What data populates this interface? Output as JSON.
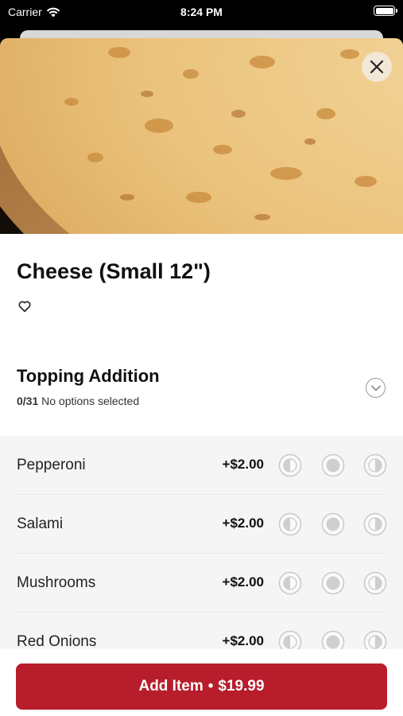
{
  "status_bar": {
    "carrier": "Carrier",
    "time": "8:24 PM"
  },
  "item": {
    "title": "Cheese (Small 12\")"
  },
  "modifier_group": {
    "title": "Topping Addition",
    "selected_count": "0/31",
    "status_text": "No options selected"
  },
  "options": [
    {
      "name": "Pepperoni",
      "price": "+$2.00"
    },
    {
      "name": "Salami",
      "price": "+$2.00"
    },
    {
      "name": "Mushrooms",
      "price": "+$2.00"
    },
    {
      "name": "Red Onions",
      "price": "+$2.00"
    }
  ],
  "footer": {
    "add_label": "Add Item",
    "separator": "•",
    "total": "$19.99"
  },
  "colors": {
    "accent": "#b71d2a",
    "option_bg": "#f5f5f5",
    "close_bg": "#f3e7d8"
  },
  "icons": [
    "wifi-icon",
    "battery-icon",
    "close-icon",
    "heart-icon",
    "chevron-down-icon",
    "left-half-icon",
    "whole-icon",
    "right-half-icon"
  ]
}
